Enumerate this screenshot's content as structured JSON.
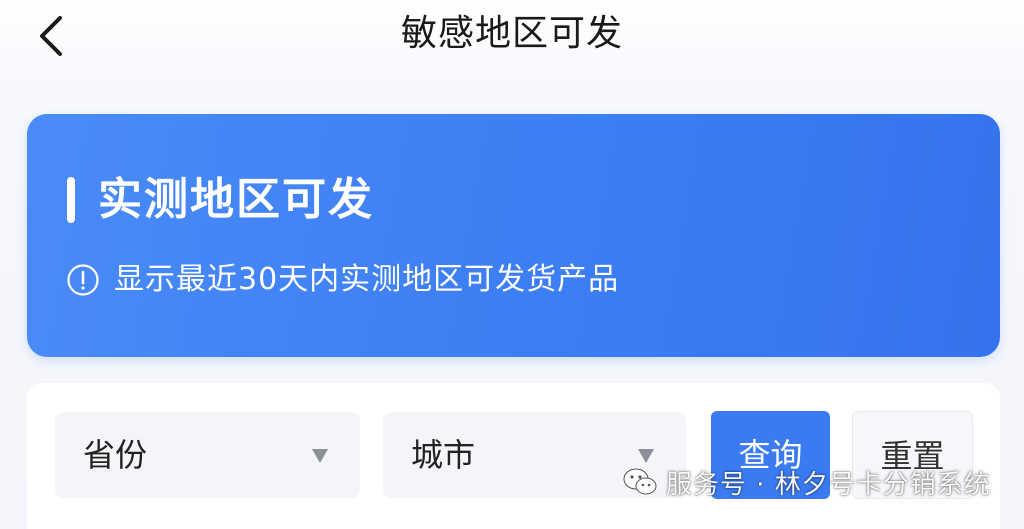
{
  "header": {
    "title": "敏感地区可发",
    "back_icon": "chevron-left-icon"
  },
  "banner": {
    "heading": "实测地区可发",
    "info_icon": "info-circle-icon",
    "info_text": "显示最近30天内实测地区可发货产品",
    "color": "#3c7ef3"
  },
  "filters": {
    "province": {
      "label": "省份",
      "icon": "caret-down-icon"
    },
    "city": {
      "label": "城市",
      "icon": "caret-down-icon"
    },
    "query_label": "查询",
    "reset_label": "重置",
    "query_color": "#3a7bf2"
  },
  "watermark": {
    "icon": "wechat-icon",
    "text": "服务号 · 林夕号卡分销系统"
  }
}
